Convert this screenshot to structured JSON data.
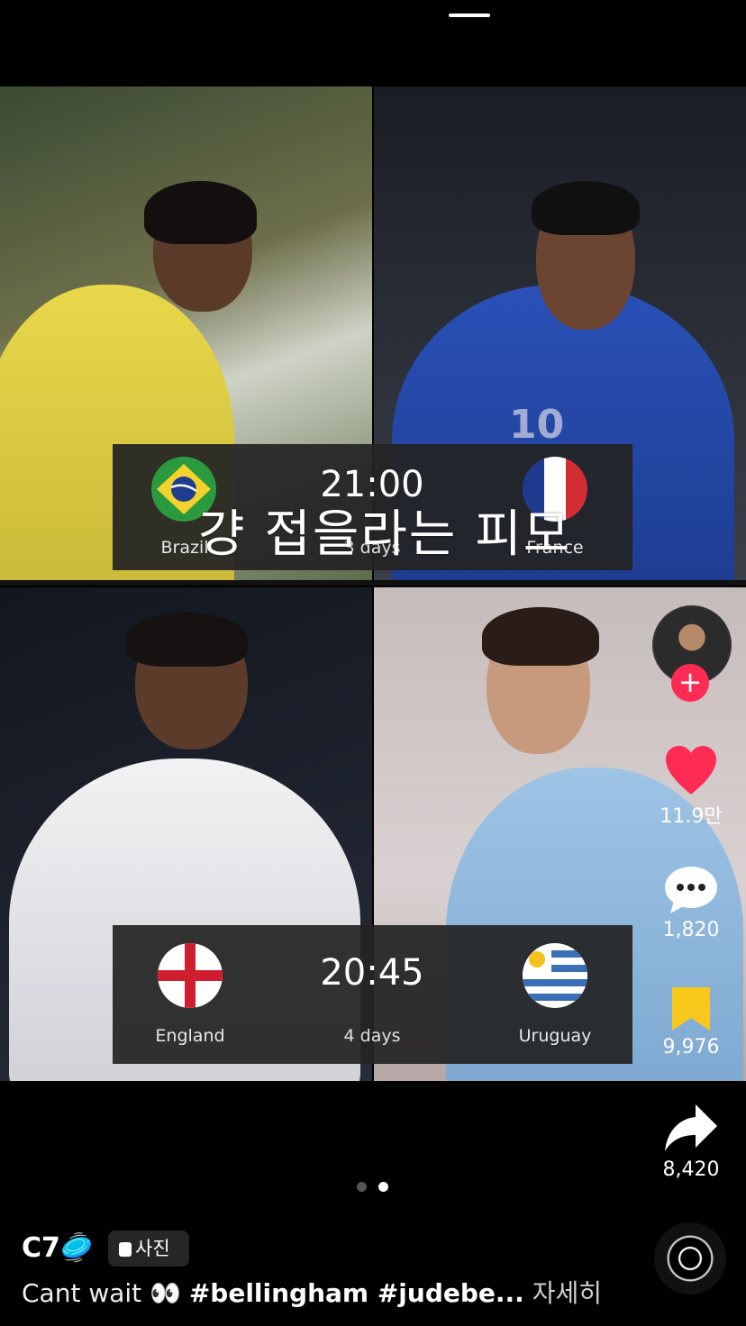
{
  "matches": [
    {
      "home": {
        "name": "Brazil"
      },
      "away": {
        "name": "France"
      },
      "time": "21:00",
      "countdown": "3 days"
    },
    {
      "home": {
        "name": "England"
      },
      "away": {
        "name": "Uruguay"
      },
      "time": "20:45",
      "countdown": "4 days"
    }
  ],
  "overlay_text": "걍 접을라는 피모",
  "rail": {
    "likes": "11.9만",
    "comments": "1,820",
    "saves": "9,976",
    "shares": "8,420"
  },
  "user": {
    "name": "C7🥏",
    "badge": "사진"
  },
  "caption": {
    "text": "Cant wait 👀 ",
    "tags": "#bellingham #judebe...",
    "more": "자세히"
  },
  "pager": {
    "count": 2,
    "active": 2
  },
  "colors": {
    "like": "#fe2c55",
    "save": "#f8c91c",
    "scoreboard": "#242424"
  },
  "icons": [
    "heart-icon",
    "comment-icon",
    "bookmark-icon",
    "share-icon",
    "plus-icon",
    "photo-icon"
  ]
}
